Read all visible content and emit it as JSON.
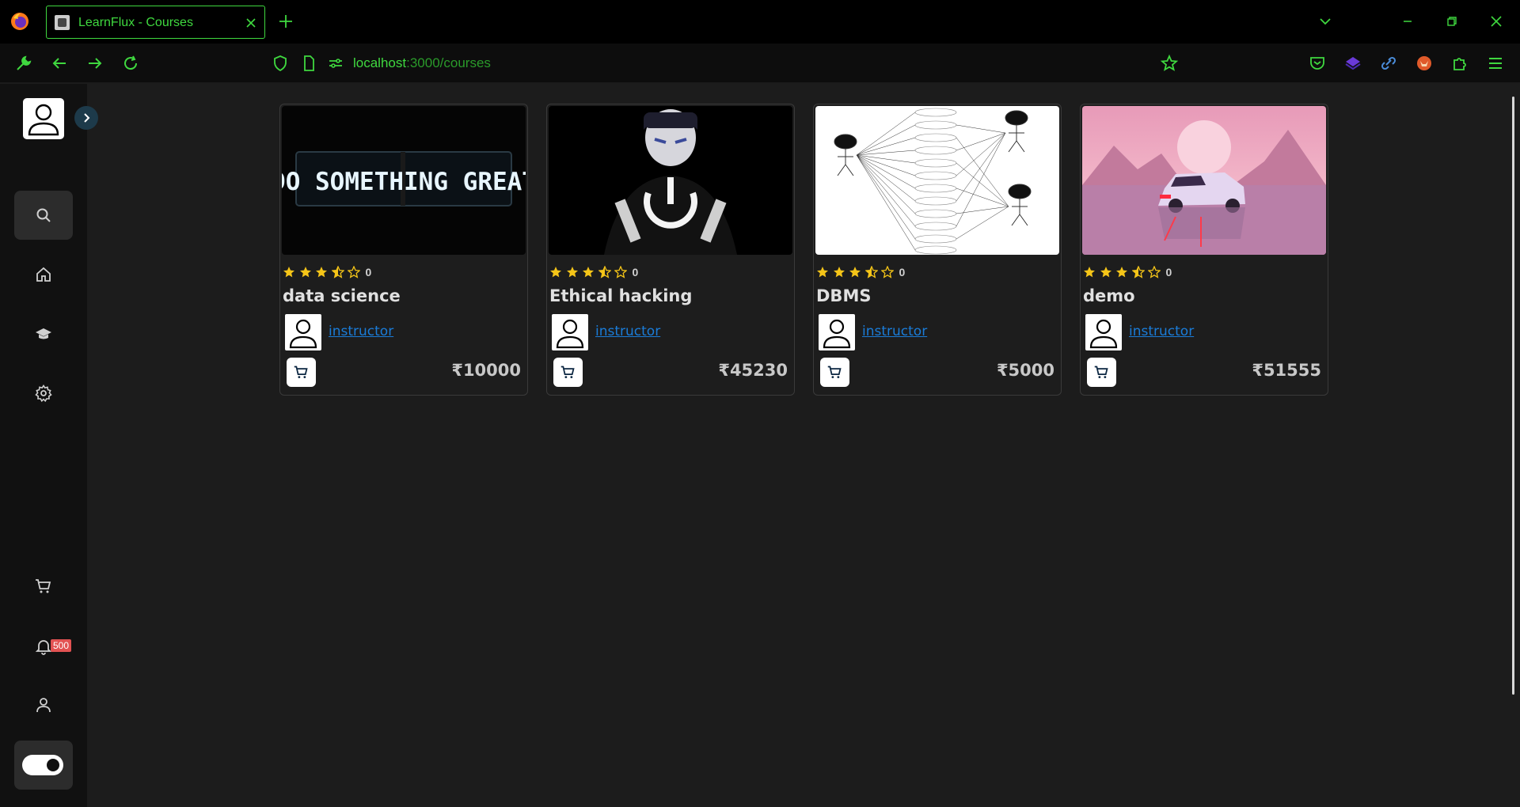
{
  "browser": {
    "tab_title": "LearnFlux - Courses",
    "url_host": "localhost",
    "url_rest": ":3000/courses",
    "accent": "#3fd83f"
  },
  "sidebar": {
    "items": [
      {
        "name": "search",
        "icon": "search-icon",
        "active": true
      },
      {
        "name": "home",
        "icon": "home-icon"
      },
      {
        "name": "courses",
        "icon": "graduation-cap-icon"
      },
      {
        "name": "settings",
        "icon": "gear-icon"
      },
      {
        "name": "cart",
        "icon": "cart-icon"
      },
      {
        "name": "notifications",
        "icon": "bell-icon"
      },
      {
        "name": "profile",
        "icon": "user-icon"
      }
    ],
    "notification_count": "500",
    "theme_toggle": "dark"
  },
  "courses": [
    {
      "title": "data science",
      "rating_count": "0",
      "instructor": "instructor",
      "price": "₹10000",
      "image": "neon-sign-do-something-great"
    },
    {
      "title": "Ethical hacking",
      "rating_count": "0",
      "instructor": "instructor",
      "price": "₹45230",
      "image": "hacker-power-symbol"
    },
    {
      "title": "DBMS",
      "rating_count": "0",
      "instructor": "instructor",
      "price": "₹5000",
      "image": "use-case-diagram"
    },
    {
      "title": "demo",
      "rating_count": "0",
      "instructor": "instructor",
      "price": "₹51555",
      "image": "pink-sunset-car"
    }
  ],
  "rating_stars": {
    "full": 3,
    "half": 1,
    "empty": 1,
    "star_color": "#f5c518"
  }
}
